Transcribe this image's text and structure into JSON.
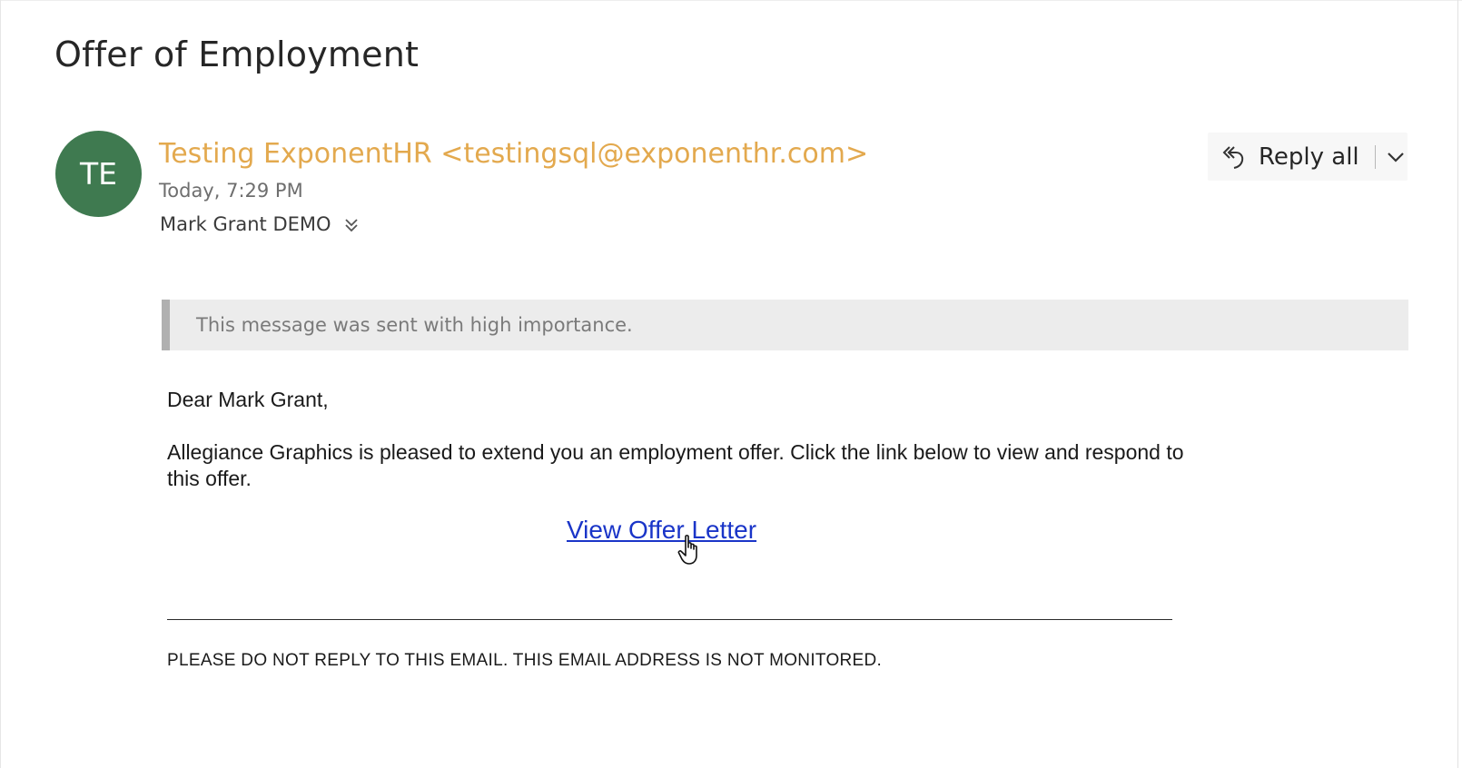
{
  "message": {
    "subject": "Offer of Employment",
    "sender": {
      "initials": "TE",
      "avatar_color": "#3f7a50",
      "display": "Testing ExponentHR <testingsql@exponenthr.com>",
      "name_color": "#e3a94e"
    },
    "date": "Today, 7:29 PM",
    "recipient": "Mark Grant DEMO",
    "importance_notice": "This message was sent with high importance."
  },
  "actions": {
    "reply_all_label": "Reply all",
    "reply_icon": "reply-all-icon",
    "dropdown_icon": "chevron-down-icon"
  },
  "body": {
    "greeting": "Dear Mark Grant,",
    "paragraph": "Allegiance Graphics is pleased to extend you an employment offer. Click the link below to view and respond to this offer.",
    "link_text": "View Offer Letter",
    "link_color": "#1a35c8",
    "footer": "PLEASE DO NOT REPLY TO THIS EMAIL. THIS EMAIL ADDRESS IS NOT MONITORED."
  }
}
